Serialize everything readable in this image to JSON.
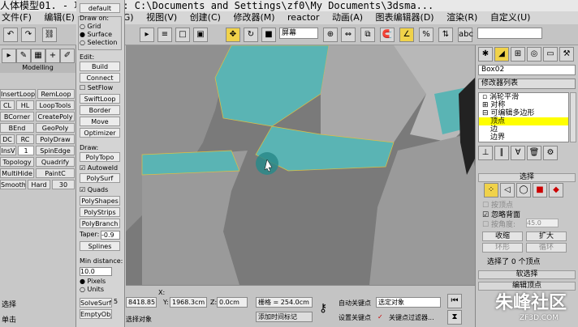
{
  "titlebar": {
    "text": "人体模型01.      - 项目文件夹: C:\\Documents and Settings\\zf0\\My Documents\\3dsma..."
  },
  "menu": {
    "items": [
      "文件(F)",
      "编辑(E)",
      "(G)",
      "视图(V)",
      "创建(C)",
      "修改器(M)",
      "reactor",
      "动画(A)",
      "图表编辑器(D)",
      "渲染(R)",
      "自定义(U)"
    ]
  },
  "toolbar": {
    "viewport_dropdown": "屏幕",
    "right_dropdown": ""
  },
  "left_panel": {
    "section": "Modelling",
    "buttons": [
      "InsertLoop",
      "RemLoop",
      "CL",
      "HL",
      "LoopTools",
      "BCorner",
      "CreatePoly",
      "BEnd",
      "GeoPoly",
      "DC",
      "RC",
      "PolyDraw",
      "InsV",
      "1",
      "SpinEdge",
      "Topology",
      "Quadrify",
      "MultiHide",
      "PaintC",
      "Smooth",
      "Hard",
      "30"
    ],
    "bottom_label": "选择",
    "bottom_label2": "单击"
  },
  "draw_panel": {
    "default_btn": "default",
    "draw_on_label": "Draw on:",
    "draw_on_options": [
      "Grid",
      "Surface",
      "Selection"
    ],
    "edit_label": "Edit:",
    "edit_buttons": [
      "Build",
      "Connect",
      "SetFlow",
      "SwiftLoop",
      "Border",
      "Move",
      "Optimizer"
    ],
    "draw_label": "Draw:",
    "draw_buttons": [
      "PolyTopo",
      "Autoweld",
      "PolySurf",
      "Quads",
      "PolyShapes",
      "PolyStrips",
      "PolyBranch"
    ],
    "taper_label": "Taper:",
    "taper_value": "-0.9",
    "splines_btn": "Splines",
    "min_distance_label": "Min distance:",
    "min_distance_value": "10.0",
    "units_options": [
      "Pixels",
      "Units"
    ],
    "solve_btn": "SolveSurf",
    "solve_value": "5",
    "empty_btn": "EmptyObj"
  },
  "right_panel": {
    "object_name": "Box02",
    "modifier_list": "修改器列表",
    "stack": [
      "涡轮平滑",
      "对称",
      "可编辑多边形",
      "顶点",
      "边",
      "边界"
    ],
    "selection_head": "选择",
    "by_vertex": "按顶点",
    "ignore_backface": "忽略背面",
    "by_angle": "按角度:",
    "angle_value": "45.0",
    "shrink": "收缩",
    "grow": "扩大",
    "ring": "环形",
    "loop": "循环",
    "selected_text": "选择了 0 个顶点",
    "soft_selection": "软选择",
    "edit_vertices": "编辑顶点"
  },
  "bottom": {
    "x_label": "X:",
    "x_value": "8418.85",
    "y_label": "Y:",
    "y_value": "1968.3cm",
    "z_label": "Z:",
    "z_value": "0.0cm",
    "grid_label": "栅格 = 254.0cm",
    "add_time_tag": "添加时间标记",
    "auto_key": "自动关键点",
    "set_key": "设置关键点",
    "selection_dropdown": "选定对象",
    "key_filters": "关键点过滤器...",
    "status_left": "选择对象"
  },
  "watermark": {
    "text": "朱峰社区",
    "subtext": "ZF3D.COM"
  },
  "colors": {
    "highlight": "#f0d24a",
    "mesh_teal": "#5ab4b4",
    "viewport_bg": "#7a7a7a",
    "selected_row": "#ffff00"
  }
}
